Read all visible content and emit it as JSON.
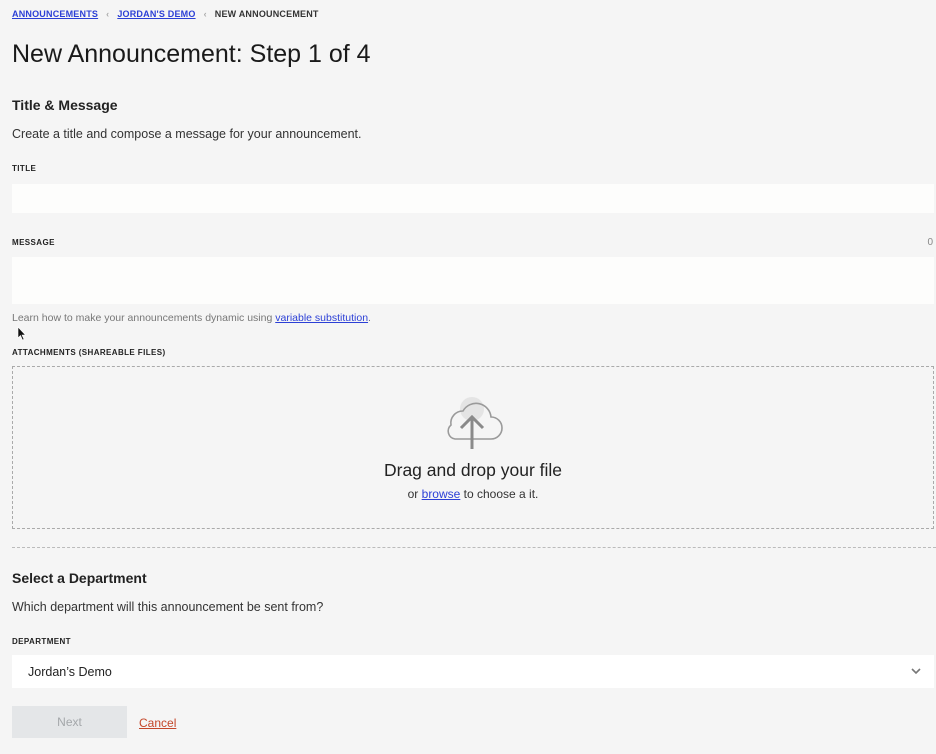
{
  "breadcrumb": {
    "items": [
      {
        "label": "ANNOUNCEMENTS",
        "link": true
      },
      {
        "label": "JORDAN'S DEMO",
        "link": true
      },
      {
        "label": "NEW ANNOUNCEMENT",
        "link": false
      }
    ]
  },
  "page_title": "New Announcement: Step 1 of 4",
  "title_message": {
    "heading": "Title & Message",
    "description": "Create a title and compose a message for your announcement.",
    "title_label": "TITLE",
    "title_value": "",
    "message_label": "MESSAGE",
    "message_value": "",
    "message_count": "0",
    "help_prefix": "Learn how to make your announcements dynamic using ",
    "help_link": "variable substitution",
    "help_suffix": "."
  },
  "attachments": {
    "label": "ATTACHMENTS (SHAREABLE FILES)",
    "icon": "cloud-upload-icon",
    "drop_title": "Drag and drop your file",
    "drop_prefix": "or ",
    "drop_link": "browse",
    "drop_suffix": " to choose a it."
  },
  "department": {
    "heading": "Select a Department",
    "description": "Which department will this announcement be sent from?",
    "label": "DEPARTMENT",
    "selected": "Jordan’s Demo"
  },
  "actions": {
    "next_label": "Next",
    "cancel_label": "Cancel"
  },
  "colors": {
    "link": "#2b3fd6",
    "cancel": "#c4472a",
    "background": "#f5f5f5"
  }
}
